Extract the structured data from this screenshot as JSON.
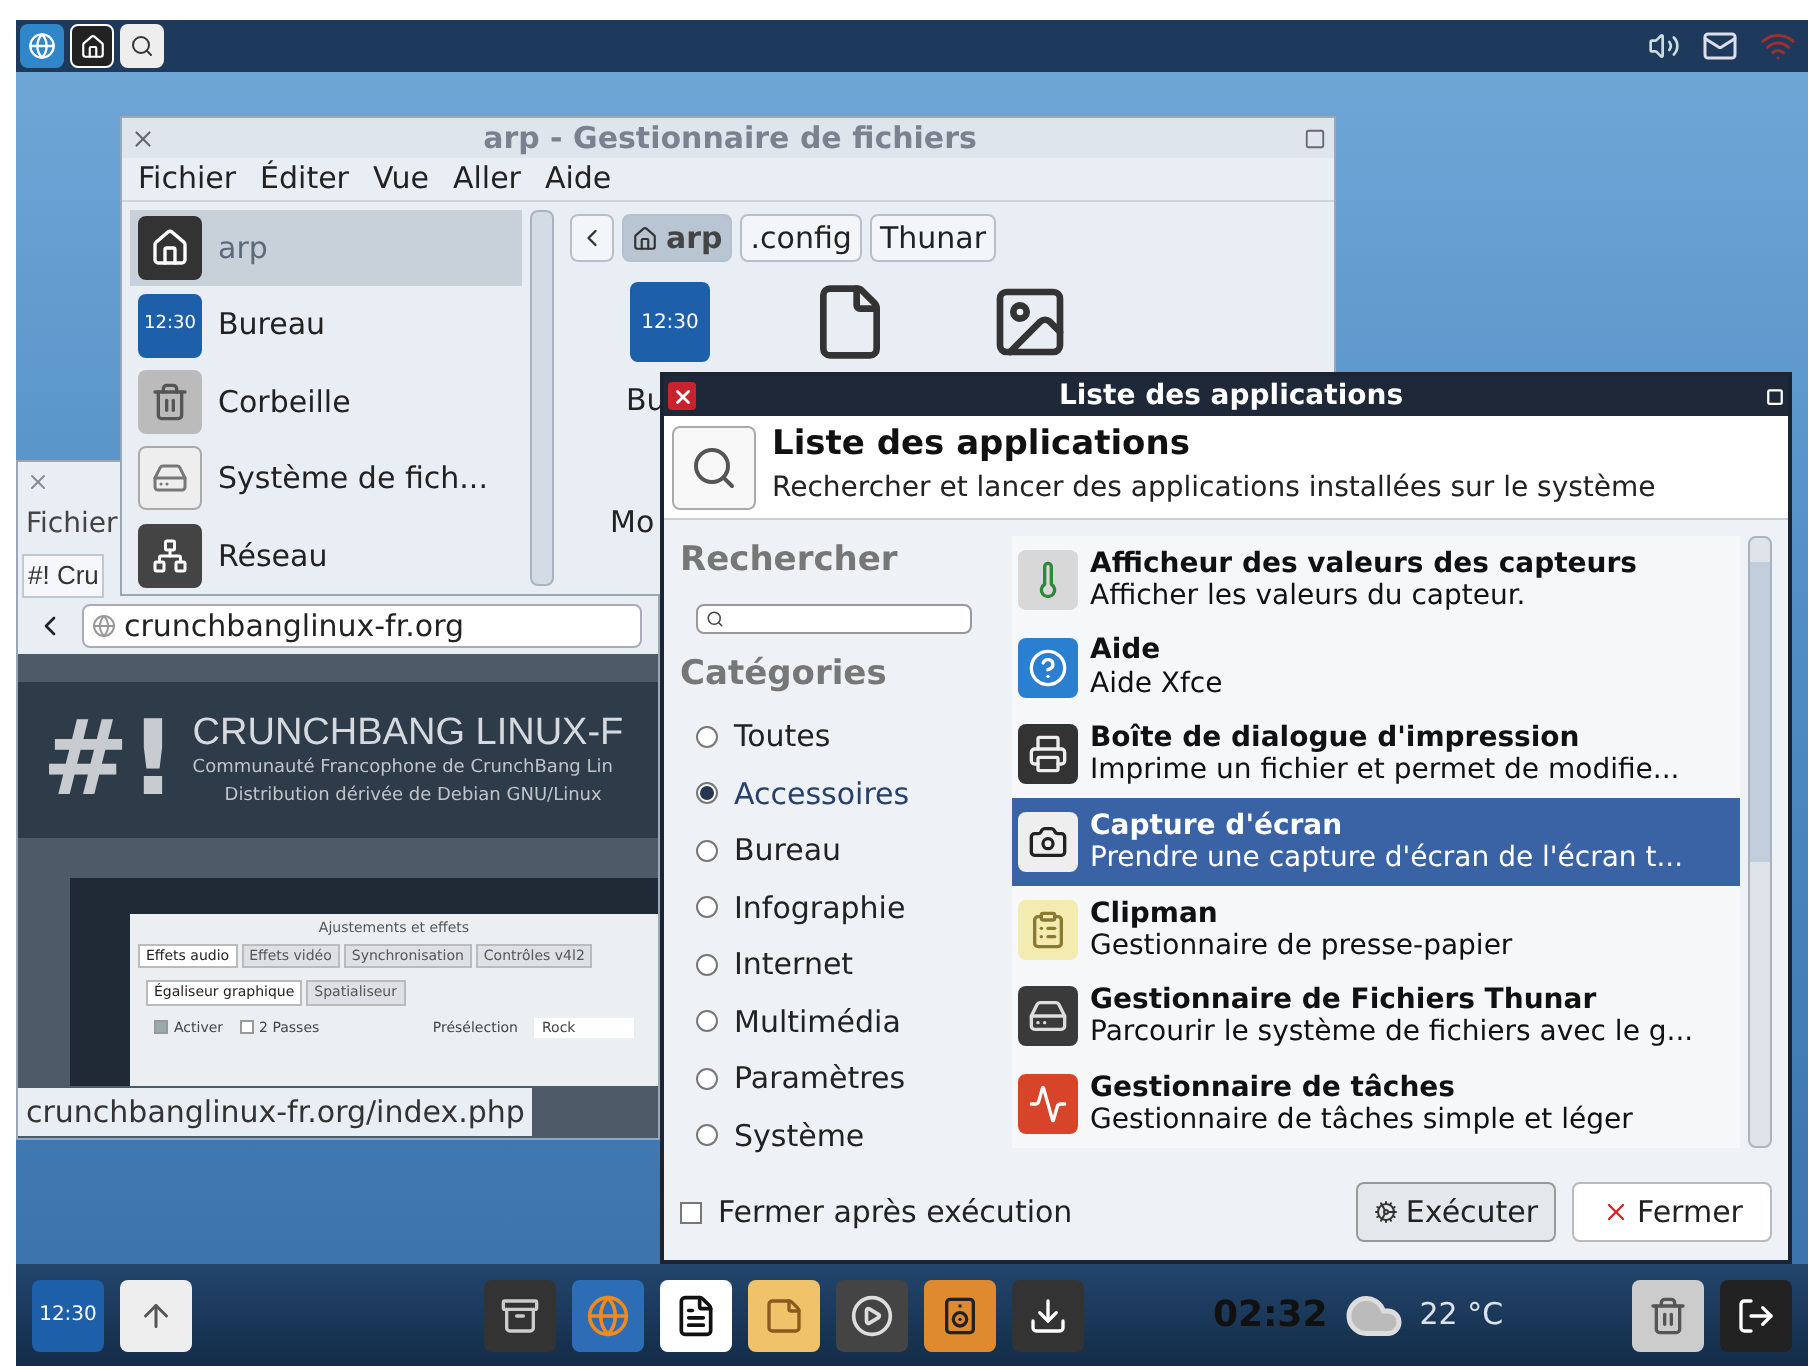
{
  "file_manager": {
    "title": "arp - Gestionnaire de fichiers",
    "menu": [
      "Fichier",
      "Éditer",
      "Vue",
      "Aller",
      "Aide"
    ],
    "places": [
      {
        "label": "arp",
        "selected": true
      },
      {
        "label": "Bureau",
        "selected": false,
        "badge": "12:30"
      },
      {
        "label": "Corbeille",
        "selected": false
      },
      {
        "label": "Système de fich...",
        "selected": false
      },
      {
        "label": "Réseau",
        "selected": false
      }
    ],
    "path": [
      {
        "label": "arp",
        "selected": true
      },
      {
        "label": ".config",
        "selected": false
      },
      {
        "label": "Thunar",
        "selected": false
      }
    ],
    "grid_badge": "12:30",
    "grid_labels": [
      "Bu",
      "Mo"
    ]
  },
  "browser": {
    "menu": [
      "Fichier"
    ],
    "tab": "#! Cru",
    "address": "crunchbanglinux-fr.org",
    "banner": {
      "logo": "#!",
      "heading": "CRUNCHBANG LINUX-F",
      "tagline": "Communauté Francophone de CrunchBang Lin",
      "subline": "Distribution dérivée de Debian GNU/Linux"
    },
    "embedded": {
      "title": "Ajustements et effets",
      "tabs": [
        {
          "label": "Effets audio",
          "selected": true
        },
        {
          "label": "Effets vidéo",
          "selected": false
        },
        {
          "label": "Synchronisation",
          "selected": false
        },
        {
          "label": "Contrôles v4l2",
          "selected": false
        }
      ],
      "subtabs": [
        {
          "label": "Égaliseur graphique",
          "selected": true
        },
        {
          "label": "Spatialiseur",
          "selected": false
        }
      ],
      "options": [
        {
          "label": "Activer",
          "checked": true
        },
        {
          "label": "2 Passes",
          "checked": false
        }
      ],
      "preset_label": "Présélection",
      "preset_value": "Rock"
    },
    "status": "crunchbanglinux-fr.org/index.php"
  },
  "app_finder": {
    "window_title": "Liste des applications",
    "heading": "Liste des applications",
    "subheading": "Rechercher et lancer des applications installées sur le système",
    "search_label": "Rechercher",
    "categories_label": "Catégories",
    "categories": [
      {
        "label": "Toutes",
        "selected": false
      },
      {
        "label": "Accessoires",
        "selected": true
      },
      {
        "label": "Bureau",
        "selected": false
      },
      {
        "label": "Infographie",
        "selected": false
      },
      {
        "label": "Internet",
        "selected": false
      },
      {
        "label": "Multimédia",
        "selected": false
      },
      {
        "label": "Paramètres",
        "selected": false
      },
      {
        "label": "Système",
        "selected": false
      }
    ],
    "apps": [
      {
        "name": "Afficheur des valeurs des capteurs",
        "description": "Afficher les valeurs du capteur.",
        "selected": false
      },
      {
        "name": "Aide",
        "description": "Aide Xfce",
        "selected": false
      },
      {
        "name": "Boîte de dialogue d'impression",
        "description": "Imprime un fichier et permet de modifie...",
        "selected": false
      },
      {
        "name": "Capture d'écran",
        "description": "Prendre une capture d'écran de l'écran t...",
        "selected": true
      },
      {
        "name": "Clipman",
        "description": "Gestionnaire de presse-papier",
        "selected": false
      },
      {
        "name": "Gestionnaire de Fichiers Thunar",
        "description": "Parcourir le système de fichiers avec le g...",
        "selected": false
      },
      {
        "name": "Gestionnaire de tâches",
        "description": "Gestionnaire de tâches simple et léger",
        "selected": false
      }
    ],
    "close_after_run": {
      "label": "Fermer après exécution",
      "checked": false
    },
    "buttons": [
      "Exécuter",
      "Fermer"
    ]
  },
  "taskbar": {
    "clock_badge": "12:30",
    "time": "02:32",
    "temperature": "22 °C"
  }
}
